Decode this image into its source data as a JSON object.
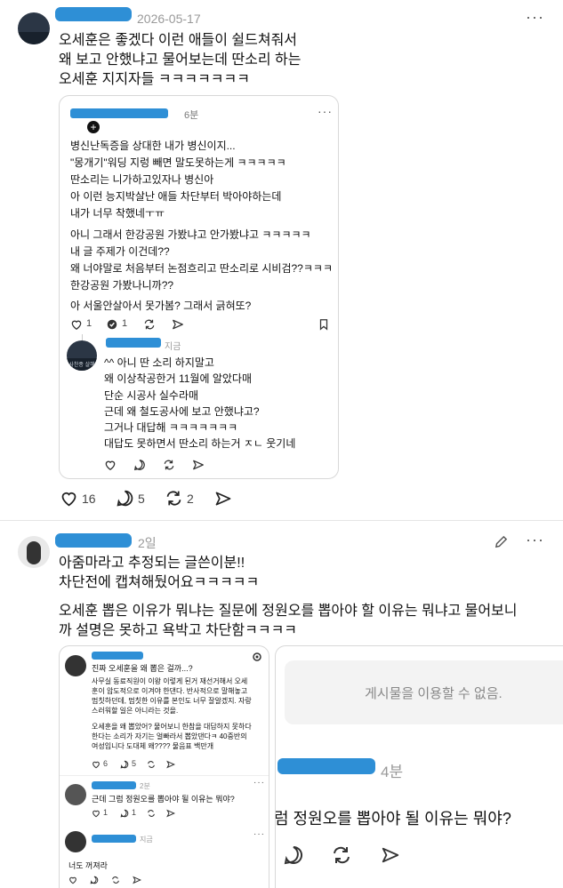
{
  "post1": {
    "date": "2026-05-17",
    "lines": [
      "오세훈은 좋겠다 이런 애들이 쉴드쳐줘서",
      "왜 보고 안했냐고 물어보는데 딴소리 하는",
      "오세훈 지지자들 ㅋㅋㅋㅋㅋㅋㅋ"
    ],
    "quoted": {
      "time": "6분",
      "para1": [
        "병신난독증을 상대한 내가 병신이지...",
        "\"몽개기\"워딩 지렁 빼면 말도못하는게 ㅋㅋㅋㅋㅋ",
        "딴소리는 니가하고있자나 병신아",
        "아 이런 능지박살난 애들 차단부터 박아야하는데",
        "내가 너무 착했네ㅜㅠ"
      ],
      "para2": [
        "아니 그래서 한강공원 가봤냐고 안가봤냐고 ㅋㅋㅋㅋㅋ",
        "내 글 주제가 이건데??",
        "왜 너야말로 처음부터 논점흐리고 딴소리로 시비검??ㅋㅋㅋ",
        "한강공원 가봤나니까??"
      ],
      "para3": "아 서울안살아서 못가봄? 그래서 긁혀또?",
      "likes": "1",
      "replies": "1",
      "reply": {
        "time": "지금",
        "avatar_text": "사찬종 살해",
        "lines": [
          "^^ 아니 딴 소리 하지말고",
          "왜 이상착공한거 11월에 알았다매",
          "단순 시공사 실수라매",
          "근데 왜 철도공사에 보고 안했냐고?",
          "그거나 대답해 ㅋㅋㅋㅋㅋㅋㅋ",
          "대답도 못하면서 딴소리 하는거 ㅈㄴ 웃기네"
        ]
      }
    },
    "likes": "16",
    "comments": "5",
    "reposts": "2"
  },
  "post2": {
    "time": "2일",
    "lines1": [
      "아줌마라고 추정되는 글쓴이분!!",
      "차단전에 캡쳐해뒀어요ㅋㅋㅋㅋㅋ"
    ],
    "lines2": [
      "오세훈 뽑은 이유가 뭐냐는 질문에 정원오를 뽑아야 할 이유는 뭐냐고 물어보니",
      "까 설명은 못하고 욕박고 차단함ㅋㅋㅋㅋ"
    ],
    "shot1": {
      "lines": [
        "진짜 오세훈을 왜 뽑은 걸까...?",
        "사무실 동료직원이 이왕 이렇게 된거 재선거해서 오세",
        "훈이 압도적으로 이겨야 한댄다. 반사적으로 말해놓고",
        "멈칫하던데, 멈칫한 이유를 본인도 너무 잘알겠지. 자랑",
        "스러워할 일은 아니라는 것을.",
        "오세훈을 왜 뽑았어? 물어보니 한참을 대답하지 못하다",
        "한다는 소리가 자기는 얼빠라서 뽑았댄다ㅋ 40중반의",
        "여성입니다 도대체 왜???? 물음표 백만개"
      ],
      "likes": "6",
      "replies": "5",
      "reply1_time": "2분",
      "reply1": "근데 그럼 정원오를 뽑아야 될 이유는 뭐야?",
      "reply1_likes": "1",
      "reply1_replies": "1",
      "reply2_time": "지금",
      "reply2": "너도 꺼져라"
    },
    "shot2": {
      "unavailable": "게시물을 이용할 수 없음.",
      "time": "4분",
      "question": "럼 정원오를 뽑아야 될 이유는 뭐야?"
    }
  }
}
